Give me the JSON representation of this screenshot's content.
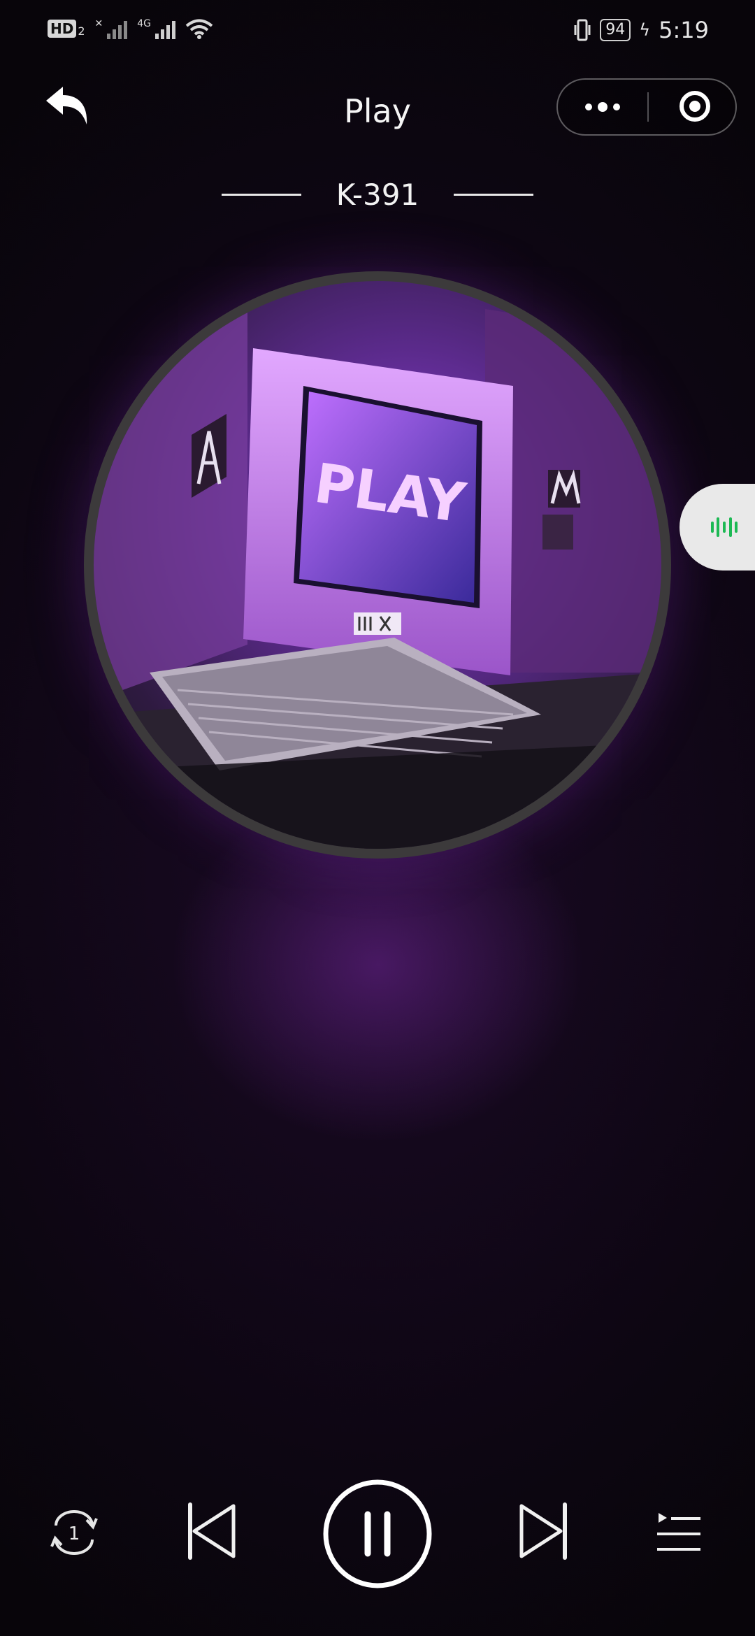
{
  "status_bar": {
    "hd_label": "HD",
    "hd_sub": "2",
    "network_label": "4G",
    "battery": "94",
    "time": "5:19"
  },
  "header": {
    "title": "Play",
    "more_icon": "more-dots-icon",
    "close_icon": "target-close-icon",
    "back_icon": "back-arrow-icon"
  },
  "track": {
    "name": "K-391"
  },
  "album_art": {
    "screen_text": "PLAY"
  },
  "controls": {
    "repeat_badge": "1",
    "icons": [
      "repeat-one-icon",
      "previous-icon",
      "pause-icon",
      "next-icon",
      "playlist-icon"
    ]
  },
  "colors": {
    "accent_green": "#1db954",
    "ring": "#3c3a3b",
    "purple": "#8a3fd6"
  }
}
